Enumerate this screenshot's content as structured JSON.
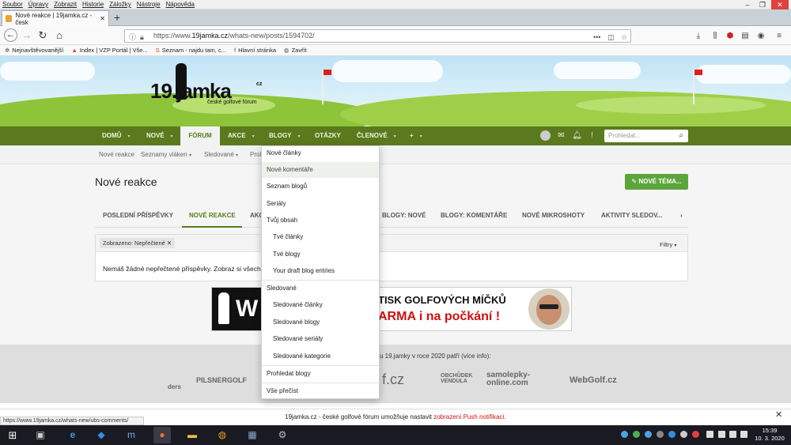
{
  "browser": {
    "menu": [
      "Soubor",
      "Úpravy",
      "Zobrazit",
      "Historie",
      "Záložky",
      "Nástroje",
      "Nápověda"
    ],
    "tab_title": "Nové reakce | 19jamka.cz - česk",
    "url_prefix": "https://www.",
    "url_domain": "19jamka.cz",
    "url_path": "/whats-new/posts/1594702/",
    "bookmarks": [
      "Nejnavštěvovanější",
      "Index | VZP Portál | Vše...",
      "Seznam - najdu tam, c...",
      "Hlavní stránka",
      "Zavřít"
    ],
    "status_url": "https://www.19jamka.cz/whats-new/ubs-comments/"
  },
  "site": {
    "logo": "19.jamka",
    "logo_cz": "cz",
    "logo_sub": "české golfové fórum",
    "nav": [
      "DOMŮ",
      "NOVÉ",
      "FÓRUM",
      "AKCE",
      "BLOGY",
      "OTÁZKY",
      "ČLENOVÉ",
      "+"
    ],
    "search_placeholder": "Prohledat...",
    "subnav": [
      "Nové reakce",
      "Seznamy vláken",
      "Sledované",
      "Prol"
    ]
  },
  "main": {
    "title": "Nové reakce",
    "new_thread": "NOVÉ TÉMA...",
    "tabs": [
      "POSLEDNÍ PŘÍSPĚVKY",
      "NOVÉ REAKCE",
      "AKC",
      "BLOGY: NOVÉ",
      "BLOGY: KOMENTÁŘE",
      "NOVÉ MIKROSHOTY",
      "AKTIVITY SLEDOV..."
    ],
    "chip_label": "Zobrazeno:",
    "chip_value": "Nepřečtené",
    "filtry": "Filtry",
    "empty": "Nemáš žádné nepřečtené příspěvky. Zobraz si všech"
  },
  "ad": {
    "t1": "TISK GOLFOVÝCH MÍČKŮ",
    "t2": "ARMA i na počkání !",
    "left": "W"
  },
  "footer": {
    "partners_text": "u 19.jamky v roce 2020 patří (více info):",
    "partners": [
      "ders",
      "PILSNERGOLF",
      "f.cz",
      "OBCHŮDEK VENDULA",
      "samolepky-online.com",
      "WebGolf.cz"
    ]
  },
  "dropdown": [
    {
      "label": "Nové články",
      "sub": false
    },
    {
      "label": "Nové komentáře",
      "sub": false
    },
    {
      "label": "Seznam blogů",
      "sub": false
    },
    {
      "label": "Seriály",
      "sub": false
    },
    {
      "label": "Tvůj obsah",
      "sub": false
    },
    {
      "label": "Tvé články",
      "sub": true
    },
    {
      "label": "Tvé blogy",
      "sub": true
    },
    {
      "label": "Your draft blog entries",
      "sub": true
    },
    {
      "label": "Sledované",
      "sub": false
    },
    {
      "label": "Sledované články",
      "sub": true
    },
    {
      "label": "Sledované blogy",
      "sub": true
    },
    {
      "label": "Sledované seriály",
      "sub": true
    },
    {
      "label": "Sledované kategorie",
      "sub": true
    },
    {
      "label": "Prohledat blogy",
      "sub": false
    },
    {
      "label": "Vše přečíst",
      "sub": false
    }
  ],
  "push": {
    "text": "19jamka.cz - české golfové fórum umožňuje nastavit ",
    "link": "zobrazení Push notifikací",
    "end": "."
  },
  "taskbar": {
    "time": "15:39",
    "date": "10. 3. 2020"
  }
}
